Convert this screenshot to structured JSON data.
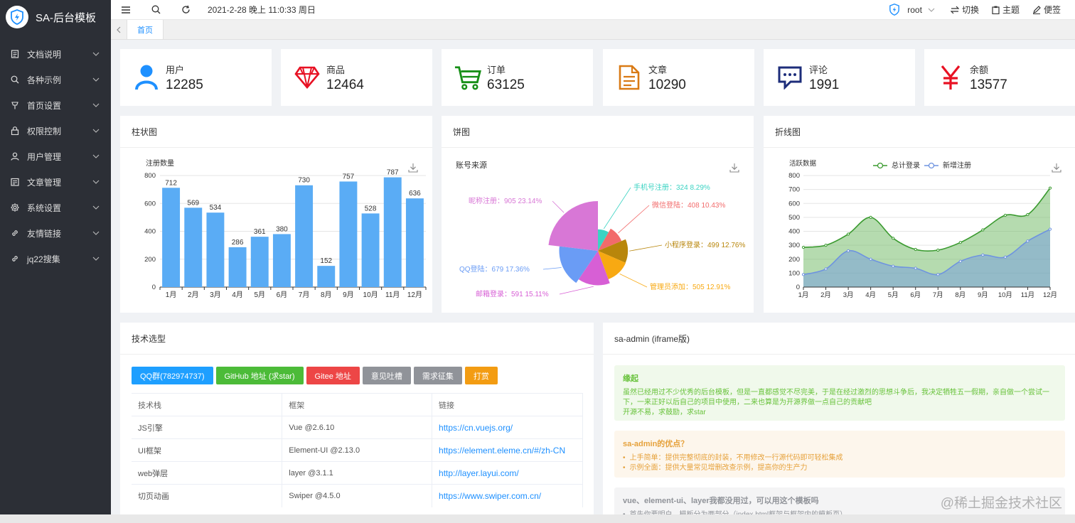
{
  "app": {
    "title": "SA-后台模板"
  },
  "sidebar": {
    "items": [
      {
        "label": "文档说明",
        "icon": "document-icon"
      },
      {
        "label": "各种示例",
        "icon": "search-icon"
      },
      {
        "label": "首页设置",
        "icon": "pin-icon"
      },
      {
        "label": "权限控制",
        "icon": "lock-icon"
      },
      {
        "label": "用户管理",
        "icon": "user-icon"
      },
      {
        "label": "文章管理",
        "icon": "article-icon"
      },
      {
        "label": "系统设置",
        "icon": "gear-icon"
      },
      {
        "label": "友情链接",
        "icon": "link-icon"
      },
      {
        "label": "jq22搜集",
        "icon": "link-icon"
      }
    ]
  },
  "topbar": {
    "datetime": "2021-2-28 晚上 11:0:33 周日",
    "user": "root",
    "switch": "切换",
    "theme": "主题",
    "notes": "便签"
  },
  "tabs": {
    "active": "首页"
  },
  "stats": [
    {
      "label": "用户",
      "value": "12285",
      "color": "#1e90ff",
      "icon": "user-icon"
    },
    {
      "label": "商品",
      "value": "12464",
      "color": "#e81123",
      "icon": "diamond-icon"
    },
    {
      "label": "订单",
      "value": "63125",
      "color": "#178f17",
      "icon": "cart-icon"
    },
    {
      "label": "文章",
      "value": "10290",
      "color": "#d97a15",
      "icon": "file-icon"
    },
    {
      "label": "评论",
      "value": "1991",
      "color": "#1d2d7a",
      "icon": "comment-icon"
    },
    {
      "label": "余额",
      "value": "13577",
      "color": "#e81123",
      "icon": "yen-icon"
    }
  ],
  "panels": {
    "bar": "柱状图",
    "pie": "饼图",
    "line": "折线图",
    "tech": "技术选型",
    "about": "sa-admin (iframe版)"
  },
  "chart_data": [
    {
      "type": "bar",
      "ylabel": "注册数量",
      "categories": [
        "1月",
        "2月",
        "3月",
        "4月",
        "5月",
        "6月",
        "7月",
        "8月",
        "9月",
        "10月",
        "11月",
        "12月"
      ],
      "values": [
        712,
        569,
        534,
        286,
        361,
        380,
        730,
        152,
        757,
        528,
        787,
        636
      ],
      "ylim": [
        0,
        800
      ],
      "yticks": [
        "0",
        "200",
        "400",
        "600",
        "800"
      ],
      "color": "#5aacf5"
    },
    {
      "type": "pie",
      "title": "账号来源",
      "slices": [
        {
          "name": "手机号注册",
          "value": 324,
          "pct": "8.29%",
          "color": "#3bd3c3"
        },
        {
          "name": "微信登陆",
          "value": 408,
          "pct": "10.43%",
          "color": "#f26b6b"
        },
        {
          "name": "小程序登录",
          "value": 499,
          "pct": "12.76%",
          "color": "#b8860b"
        },
        {
          "name": "管理员添加",
          "value": 505,
          "pct": "12.91%",
          "color": "#f8a912"
        },
        {
          "name": "邮箱登录",
          "value": 591,
          "pct": "15.11%",
          "color": "#d75fd5"
        },
        {
          "name": "QQ登陆",
          "value": 679,
          "pct": "17.36%",
          "color": "#6a9cf5"
        },
        {
          "name": "昵称注册",
          "value": 905,
          "pct": "23.14%",
          "color": "#d877d6"
        }
      ]
    },
    {
      "type": "area",
      "ylabel": "活跃数据",
      "categories": [
        "1月",
        "2月",
        "3月",
        "4月",
        "5月",
        "6月",
        "7月",
        "8月",
        "9月",
        "10月",
        "11月",
        "12月"
      ],
      "ylim": [
        0,
        800
      ],
      "yticks": [
        "0",
        "100",
        "200",
        "300",
        "400",
        "500",
        "600",
        "700",
        "800"
      ],
      "series": [
        {
          "name": "总计登录",
          "values": [
            285,
            300,
            380,
            500,
            350,
            270,
            265,
            320,
            410,
            515,
            520,
            710
          ],
          "color": "#3a9a2f"
        },
        {
          "name": "新增注册",
          "values": [
            90,
            130,
            260,
            200,
            150,
            135,
            90,
            185,
            230,
            215,
            330,
            415
          ],
          "color": "#6e93e0"
        }
      ]
    }
  ],
  "tech": {
    "buttons": [
      {
        "label": "QQ群(782974737)",
        "color": "#1e9fff"
      },
      {
        "label": "GitHub 地址 (求star)",
        "color": "#4cbb38"
      },
      {
        "label": "Gitee 地址",
        "color": "#ed4646"
      },
      {
        "label": "意见吐槽",
        "color": "#909399"
      },
      {
        "label": "需求征集",
        "color": "#909399"
      },
      {
        "label": "打赏",
        "color": "#f39c12"
      }
    ],
    "columns": [
      "技术栈",
      "框架",
      "链接"
    ],
    "rows": [
      [
        "JS引擎",
        "Vue @2.6.10",
        "https://cn.vuejs.org/"
      ],
      [
        "UI框架",
        "Element-UI @2.13.0",
        "https://element.eleme.cn/#/zh-CN"
      ],
      [
        "web弹层",
        "layer @3.1.1",
        "http://layer.layui.com/"
      ],
      [
        "切页动画",
        "Swiper @4.5.0",
        "https://www.swiper.com.cn/"
      ]
    ]
  },
  "about": {
    "n1": {
      "title": "缘起",
      "text": "虽然已经用过不少优秀的后台模板，但是一直都感觉不尽完美，于是在经过激烈的思想斗争后，我决定牺牲五一假期，亲自做一个尝试一下，一来正好以后自己的项目中使用，二来也算是为开源界做一点自己的贡献吧",
      "text2": "开源不易，求鼓励，求star"
    },
    "n2": {
      "title": "sa-admin的优点？",
      "items": [
        "上手简单：提供完整彻底的封装，不用修改一行源代码即可轻松集成",
        "示例全面：提供大量常见增删改查示例，提高你的生产力"
      ]
    },
    "n3": {
      "title": "vue、element-ui、layer我都没用过，可以用这个模板吗",
      "items": [
        "首先你要明白，模板分为两部分（index.html框架与框架内的模板页）"
      ]
    }
  },
  "watermark": "@稀土掘金技术社区"
}
